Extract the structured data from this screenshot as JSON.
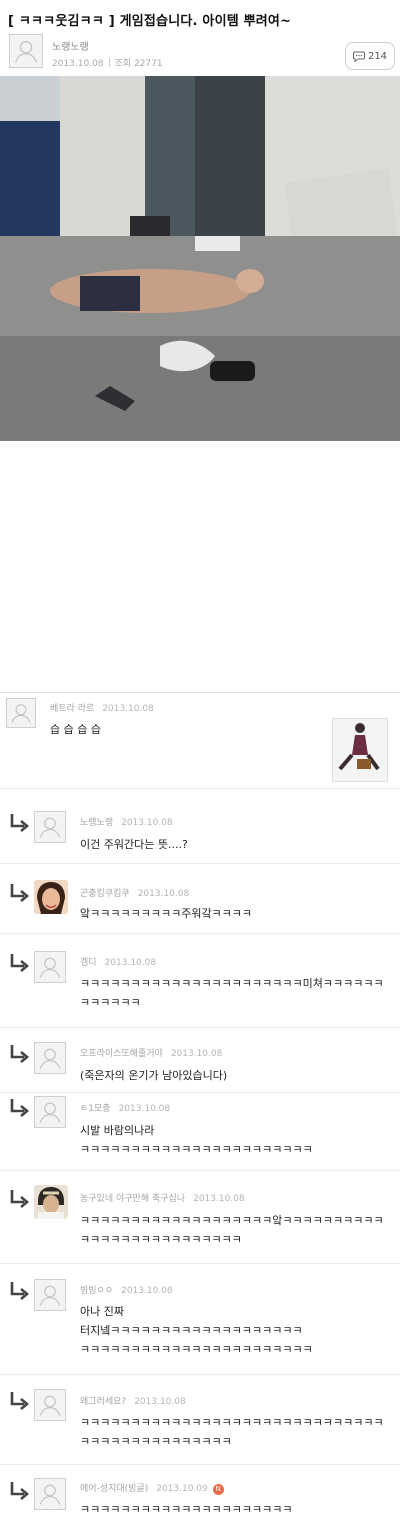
{
  "post": {
    "title": "[ ㅋㅋㅋ웃김ㅋㅋ ] 게임접습니다. 아이템 뿌려여~",
    "author": "노랭노랭",
    "date": "2013.10.08",
    "views_label": "조회",
    "views": "22771",
    "comment_count": "214"
  },
  "comments": [
    {
      "name": "베트라 라르",
      "date": "2013.10.08",
      "text": "습 습 습 습"
    },
    {
      "name": "노랭노랭",
      "date": "2013.10.08",
      "text": "이건 주워간다는 뜻....?"
    },
    {
      "name": "곤충킹쿠킹쿠",
      "date": "2013.10.08",
      "text": "앜ㅋㅋㅋㅋㅋㅋㅋㅋㅋ주워갘ㅋㅋㅋㅋ"
    },
    {
      "name": "겜디",
      "date": "2013.10.08",
      "text": "ㅋㅋㅋㅋㅋㅋㅋㅋㅋㅋㅋㅋㅋㅋㅋㅋㅋㅋㅋㅋㅋㅋ미쳐ㅋㅋㅋㅋㅋㅋㅋㅋㅋㅋㅋㅋ"
    },
    {
      "name": "오프라이스또해줄거야",
      "date": "2013.10.08",
      "text": "(죽은자의 온기가 남아있습니다)"
    },
    {
      "name": "ㅌ1모충",
      "date": "2013.10.08",
      "text": "시발 바람의나라\nㅋㅋㅋㅋㅋㅋㅋㅋㅋㅋㅋㅋㅋㅋㅋㅋㅋㅋㅋㅋㅋㅋㅋ"
    },
    {
      "name": "농구있네 야구만해 축구십나",
      "date": "2013.10.08",
      "text": "ㅋㅋㅋㅋㅋㅋㅋㅋㅋㅋㅋㅋㅋㅋㅋㅋㅋㅋㅋ앜ㅋㅋㅋㅋㅋㅋㅋㅋㅋㅋㅋㅋㅋㅋㅋㅋㅋㅋㅋㅋㅋㅋㅋㅋㅋㅋ"
    },
    {
      "name": "빙빙ㅇㅇ",
      "date": "2013.10.08",
      "text": "아나 진짜\n터지넼ㅋㅋㅋㅋㅋㅋㅋㅋㅋㅋㅋㅋㅋㅋㅋㅋㅋㅋㅋ\nㅋㅋㅋㅋㅋㅋㅋㅋㅋㅋㅋㅋㅋㅋㅋㅋㅋㅋㅋㅋㅋㅋㅋ"
    },
    {
      "name": "왜그러세요?",
      "date": "2013.10.08",
      "text": "ㅋㅋㅋㅋㅋㅋㅋㅋㅋㅋㅋㅋㅋㅋㅋㅋㅋㅋㅋㅋㅋㅋㅋㅋㅋㅋㅋㅋㅋㅋㅋㅋㅋㅋㅋㅋㅋㅋㅋㅋㅋㅋㅋㅋㅋ"
    },
    {
      "name": "에어-성지대(빙글)",
      "date": "2013.10.09",
      "badge": "N",
      "text": "ㅋㅋㅋㅋㅋㅋㅋㅋㅋㅋㅋㅋㅋㅋㅋㅋㅋㅋㅋㅋㅋ"
    }
  ]
}
